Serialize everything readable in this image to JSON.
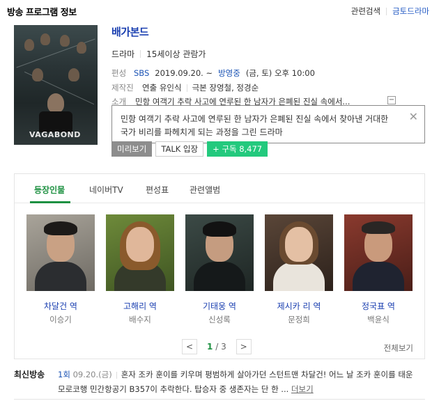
{
  "header": {
    "title": "방송 프로그램 정보",
    "link_related": "관련검색",
    "link_goldrama": "금토드라마"
  },
  "poster": {
    "logo_text": "VAGABOND"
  },
  "program": {
    "title": "배가본드",
    "genre": "드라마",
    "rating": "15세이상 관람가",
    "schedule_label": "편성",
    "channel": "SBS",
    "date": "2019.09.20. ~",
    "status": "방영중",
    "airtime": "(금, 토) 오후 10:00",
    "production_label": "제작진",
    "director": "연출 유인식",
    "writer": "극본 장영철, 정경순",
    "intro_label": "소개",
    "intro_short": "민항 여객기 추락 사고에 연루된 한 남자가 은폐된 진실 속에서...",
    "more_symbol": "−",
    "intro_full": "민항 여객기 추락 사고에 연루된 한 남자가 은폐된 진실 속에서 찾아낸 거대한 국가 비리를 파헤치게 되는 과정을 그린 드라마"
  },
  "buttons": {
    "preview": "미리보기",
    "talk": "TALK 입장",
    "subscribe": "+ 구독 8,477"
  },
  "cast_tabs": [
    "등장인물",
    "네이버TV",
    "편성표",
    "관련앨범"
  ],
  "cast": [
    {
      "role": "차달건 역",
      "actor": "이승기"
    },
    {
      "role": "고해리 역",
      "actor": "배수지"
    },
    {
      "role": "기태웅 역",
      "actor": "신성록"
    },
    {
      "role": "제시카 리 역",
      "actor": "문정희"
    },
    {
      "role": "정국표 역",
      "actor": "백윤식"
    }
  ],
  "pager": {
    "prev": "<",
    "current": "1",
    "separator": "/",
    "total": "3",
    "next": ">"
  },
  "view_all": "전체보기",
  "recent": {
    "label": "최신방송",
    "episode": "1회",
    "date": "09.20.(금)",
    "text": "혼자 조카 훈이를 키우며 평범하게 살아가던 스턴트맨 차달건! 어느 날 조카 훈이를 태운 모로코행 민간항공기 B357이 추락한다. 탑승자 중 생존자는 단 한 ...",
    "more": "더보기"
  },
  "colors": {
    "accent_green": "#1e9142",
    "link_blue": "#1a3fb0",
    "subscribe_green": "#23c97d"
  }
}
